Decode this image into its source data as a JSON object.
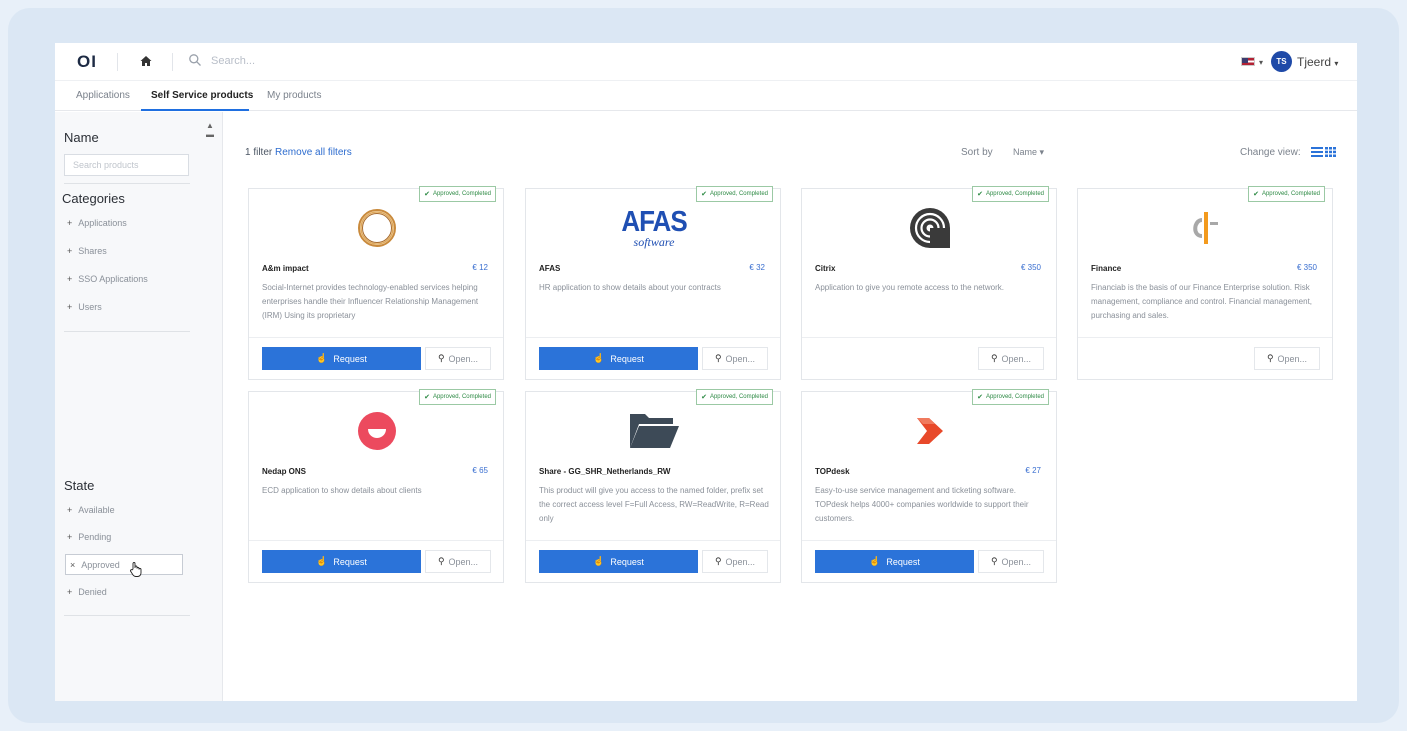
{
  "topbar": {
    "logo": "OI",
    "search_placeholder": "Search...",
    "user_initials": "TS",
    "user_name": "Tjeerd"
  },
  "tabs": [
    {
      "label": "Applications"
    },
    {
      "label": "Self Service products",
      "active": true
    },
    {
      "label": "My products"
    }
  ],
  "sidebar": {
    "name_title": "Name",
    "search_placeholder": "Search products",
    "categories_title": "Categories",
    "categories": [
      {
        "label": "Applications"
      },
      {
        "label": "Shares"
      },
      {
        "label": "SSO Applications"
      },
      {
        "label": "Users"
      }
    ],
    "state_title": "State",
    "states": [
      {
        "label": "Available",
        "selected": false
      },
      {
        "label": "Pending",
        "selected": false
      },
      {
        "label": "Approved",
        "selected": true
      },
      {
        "label": "Denied",
        "selected": false
      }
    ]
  },
  "toolbar": {
    "filter_count": "1 filter",
    "remove_filters": "Remove all filters",
    "sort_label": "Sort by",
    "sort_value": "Name",
    "view_label": "Change view:"
  },
  "products": [
    {
      "name": "A&m impact",
      "price": "€ 12",
      "badge": "Approved, Completed",
      "desc": "Social-Internet provides technology-enabled services helping enterprises handle their Influencer Relationship Management (IRM) Using its proprietary",
      "request": "Request",
      "open": "Open...",
      "logo": "ring-logo"
    },
    {
      "name": "AFAS",
      "price": "€ 32",
      "badge": "Approved, Completed",
      "desc": "HR application to show details about your contracts",
      "request": "Request",
      "open": "Open...",
      "logo": "afas-logo",
      "logo_text": "AFAS",
      "logo_sub": "software"
    },
    {
      "name": "Citrix",
      "price": "€ 350",
      "badge": "Approved, Completed",
      "desc": "Application to give you remote access to the network.",
      "open": "Open...",
      "logo": "citrix-logo"
    },
    {
      "name": "Finance",
      "price": "€ 350",
      "badge": "Approved, Completed",
      "desc": "Financiab is the basis of our Finance Enterprise solution. Risk management, compliance and control. Financial management, purchasing and sales.",
      "open": "Open...",
      "logo": "finance-logo"
    },
    {
      "name": "Nedap ONS",
      "price": "€ 65",
      "badge": "Approved, Completed",
      "desc": "ECD application to show details about clients",
      "request": "Request",
      "open": "Open...",
      "logo": "nedap-logo"
    },
    {
      "name": "Share - GG_SHR_Netherlands_RW",
      "badge": "Approved, Completed",
      "desc": "This product will give you access to the named folder, prefix set the correct access level F=Full Access, RW=ReadWrite, R=Read only",
      "request": "Request",
      "open": "Open...",
      "logo": "folder-icon"
    },
    {
      "name": "TOPdesk",
      "price": "€ 27",
      "badge": "Approved, Completed",
      "desc": "Easy-to-use service management and ticketing software. TOPdesk helps 4000+ companies worldwide to support their customers.",
      "request": "Request",
      "open": "Open...",
      "logo": "topdesk-logo"
    }
  ],
  "colors": {
    "primary": "#2b73d9",
    "badge_green": "#2d8a44",
    "nedap": "#ec4a5e",
    "topdesk": "#e8492a",
    "finance": "#f39a1d"
  }
}
